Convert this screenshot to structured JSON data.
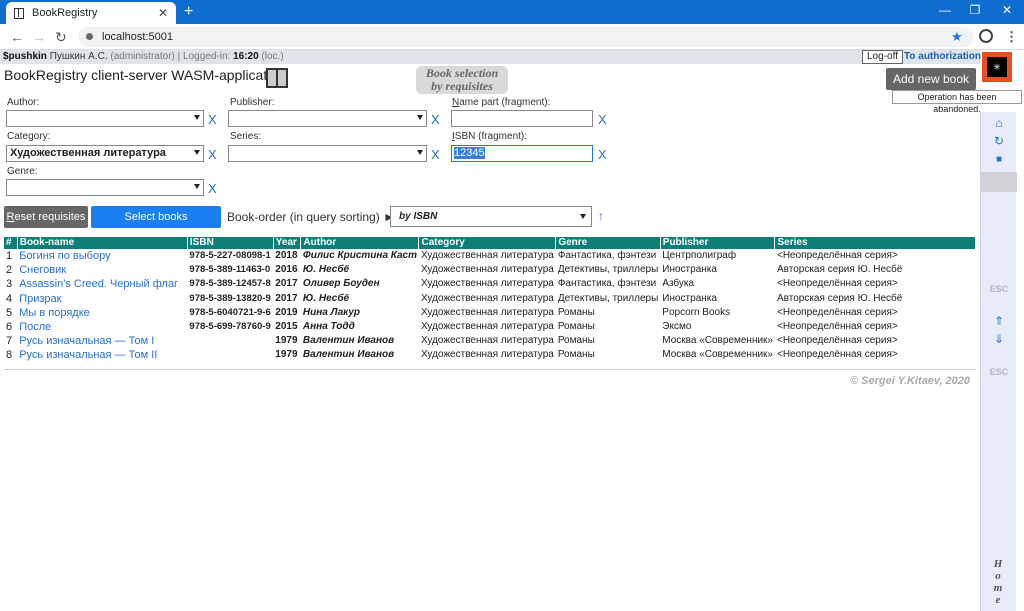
{
  "browser": {
    "tab_title": "BookRegistry",
    "tab_close": "✕",
    "new_tab": "+",
    "url": "localhost:5001",
    "win_min": "—",
    "win_max": "❐",
    "win_close": "✕"
  },
  "status": {
    "user_login": "$pushkin",
    "user_name": "Пушкин А.С.",
    "role": "(administrator)",
    "logged_in_label": "| Logged-in:",
    "logged_in_time": "16:20",
    "loc": "(loc.)",
    "logoff": "Log-off",
    "to_auth": "To authorization",
    "corner_btn": "✳"
  },
  "header": {
    "title": "BookRegistry client-server WASM-application",
    "book_selection_line1": "Book selection",
    "book_selection_line2": "by requisites",
    "add_new_book": "Add new book",
    "tooltip": "Operation has been abandoned."
  },
  "form": {
    "author_label": "Author:",
    "author_value": "",
    "publisher_label": "Publisher:",
    "publisher_value": "",
    "name_part_label_u": "N",
    "name_part_label_rest": "ame part (fragment):",
    "name_part_value": "",
    "category_label": "Category:",
    "category_value": "Художественная литература",
    "series_label": "Series:",
    "series_value": "",
    "isbn_label_u": "I",
    "isbn_label_rest": "SBN (fragment):",
    "isbn_value": "12345",
    "genre_label": "Genre:",
    "genre_value": "",
    "clear": "X"
  },
  "actions": {
    "reset_u": "R",
    "reset_rest": "eset requisites",
    "select_books": "Select books",
    "order_label": "Book-order (in query sorting) ►",
    "order_value": "by ISBN",
    "sort_direction": "↑"
  },
  "table": {
    "headers": [
      "#",
      "Book-name",
      "ISBN",
      "Year",
      "Author",
      "Category",
      "Genre",
      "Publisher",
      "Series"
    ],
    "rows": [
      [
        "1",
        "Богиня по выбору",
        "978-5-227-08098-1",
        "2018",
        "Филис Кристина Каст",
        "Художественная литература",
        "Фантастика, фэнтези",
        "Центрполиграф",
        "<Неопределённая серия>"
      ],
      [
        "2",
        "Снеговик",
        "978-5-389-11463-0",
        "2016",
        "Ю. Несбё",
        "Художественная литература",
        "Детективы, триллеры",
        "Иностранка",
        "Авторская серия Ю. Несбё"
      ],
      [
        "3",
        "Assassin's Creed. Черный флаг",
        "978-5-389-12457-8",
        "2017",
        "Оливер Боуден",
        "Художественная литература",
        "Фантастика, фэнтези",
        "Азбука",
        "<Неопределённая серия>"
      ],
      [
        "4",
        "Призрак",
        "978-5-389-13820-9",
        "2017",
        "Ю. Несбё",
        "Художественная литература",
        "Детективы, триллеры",
        "Иностранка",
        "Авторская серия Ю. Несбё"
      ],
      [
        "5",
        "Мы в порядке",
        "978-5-6040721-9-6",
        "2019",
        "Нина Лакур",
        "Художественная литература",
        "Романы",
        "Popcorn Books",
        "<Неопределённая серия>"
      ],
      [
        "6",
        "После",
        "978-5-699-78760-9",
        "2015",
        "Анна Тодд",
        "Художественная литература",
        "Романы",
        "Эксмо",
        "<Неопределённая серия>"
      ],
      [
        "7",
        "Русь изначальная — Том I",
        "",
        "1979",
        "Валентин Иванов",
        "Художественная литература",
        "Романы",
        "Москва «Современник»",
        "<Неопределённая серия>"
      ],
      [
        "8",
        "Русь изначальная — Том II",
        "",
        "1979",
        "Валентин Иванов",
        "Художественная литература",
        "Романы",
        "Москва «Современник»",
        "<Неопределённая серия>"
      ]
    ]
  },
  "footer": {
    "copyright": "© Sergei Y.Kitaev, 2020"
  },
  "side": {
    "home_icon": "⌂",
    "refresh_icon": "↻",
    "stop_icon": "■",
    "esc1": "ESC",
    "up_icon": "⇑",
    "down_icon": "⇓",
    "esc2": "ESC",
    "home_vertical": "Home"
  },
  "colors": {
    "header_teal": "#0d7f78",
    "link_blue": "#2a6fc9",
    "select_btn_blue": "#1a7ff0",
    "corner_orange": "#e8501c"
  }
}
